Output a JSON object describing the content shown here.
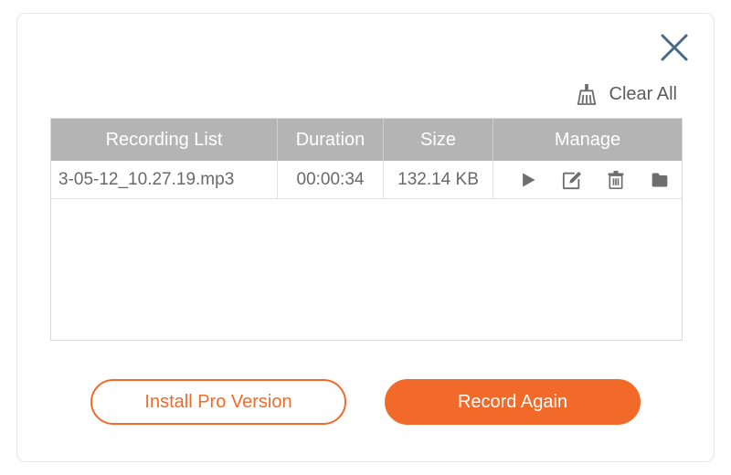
{
  "accent": "#f26a2a",
  "actions": {
    "clear_all": "Clear All"
  },
  "table": {
    "headers": {
      "name": "Recording List",
      "duration": "Duration",
      "size": "Size",
      "manage": "Manage"
    },
    "rows": [
      {
        "name": "3-05-12_10.27.19.mp3",
        "duration": "00:00:34",
        "size": "132.14 KB"
      }
    ]
  },
  "buttons": {
    "install_pro": "Install Pro Version",
    "record_again": "Record Again"
  }
}
